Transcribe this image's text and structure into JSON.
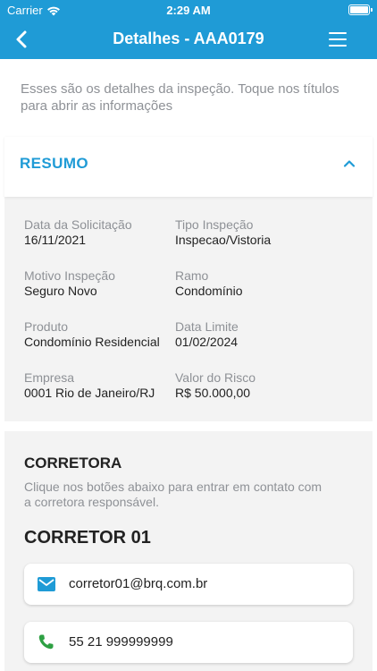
{
  "status_bar": {
    "carrier": "Carrier",
    "time": "2:29 AM"
  },
  "nav": {
    "title": "Detalhes - AAA0179"
  },
  "intro": "Esses são os detalhes da inspeção. Toque nos títulos para abrir as informações",
  "summary": {
    "heading": "RESUMO",
    "fields": [
      {
        "label": "Data da Solicitação",
        "value": "16/11/2021"
      },
      {
        "label": "Tipo Inspeção",
        "value": "Inspecao/Vistoria"
      },
      {
        "label": "Motivo Inspeção",
        "value": "Seguro Novo"
      },
      {
        "label": "Ramo",
        "value": "Condomínio"
      },
      {
        "label": "Produto",
        "value": "Condomínio Residencial"
      },
      {
        "label": "Data Limite",
        "value": "01/02/2024"
      },
      {
        "label": "Empresa",
        "value": "0001 Rio de Janeiro/RJ"
      },
      {
        "label": "Valor do Risco",
        "value": "R$ 50.000,00"
      }
    ]
  },
  "broker": {
    "heading": "CORRETORA",
    "subtitle": "Clique nos botões abaixo para entrar em contato com a corretora responsável.",
    "name": "CORRETOR 01",
    "email": "corretor01@brq.com.br",
    "phone": "55 21 999999999"
  },
  "colors": {
    "accent": "#1f9bd6",
    "contact_icon": "#1f9bd6",
    "phone_icon": "#2ea043"
  },
  "icons": [
    "wifi-icon",
    "battery-icon",
    "back-chevron-icon",
    "hamburger-menu-icon",
    "chevron-up-icon",
    "email-icon",
    "phone-icon"
  ]
}
